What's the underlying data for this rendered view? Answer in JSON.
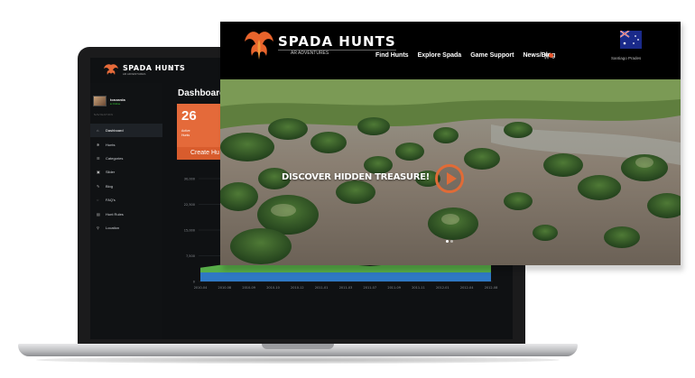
{
  "colors": {
    "accent": "#e46a3a",
    "bar": "#2f78c4",
    "area": "#5fbf4f"
  },
  "admin": {
    "logo": "SPADA HUNTS",
    "logo_sub": "AR ADVENTURES",
    "menu_icon": "hamburger-icon",
    "user_name": "tonzarda",
    "user_status": "● Online",
    "nav_header": "NAVIGATION",
    "nav": [
      {
        "label": "Dashboard",
        "icon": "home-icon"
      },
      {
        "label": "Hunts",
        "icon": "target-icon"
      },
      {
        "label": "Categories",
        "icon": "list-icon"
      },
      {
        "label": "Slider",
        "icon": "image-icon"
      },
      {
        "label": "Blog",
        "icon": "pencil-icon"
      },
      {
        "label": "FAQ's",
        "icon": "comments-icon"
      },
      {
        "label": "Hunt Rules",
        "icon": "book-icon"
      },
      {
        "label": "Location",
        "icon": "pin-icon"
      }
    ],
    "page_title": "Dashboard",
    "card": {
      "count": "26",
      "label_line1": "Active",
      "label_line2": "Hunts",
      "button": "Create Hu"
    }
  },
  "chart_data": {
    "type": "area",
    "yticks": [
      "30,000",
      "22,500",
      "15,000",
      "7,500",
      "0"
    ],
    "xticks": [
      "2010-04",
      "2010-08",
      "2010-09",
      "2010-10",
      "2010-12",
      "2011-01",
      "2011-03",
      "2011-07",
      "2011-09",
      "2011-11",
      "2012-01",
      "2012-04",
      "2012-08"
    ],
    "series": [
      {
        "values": [
          4000,
          5000,
          5500,
          5000,
          5000,
          5500,
          5000,
          4500,
          5000,
          5000,
          5000,
          5000,
          5000
        ]
      }
    ]
  },
  "site": {
    "brand": "SPADA HUNTS",
    "tagline": "AR ADVENTURES",
    "menu": [
      "Find Hunts",
      "Explore Spada",
      "Game Support",
      "News/Blog"
    ],
    "cart_icon": "cart-icon",
    "user": "Santiago Prades",
    "hero_text": "DISCOVER HIDDEN TREASURE!"
  }
}
